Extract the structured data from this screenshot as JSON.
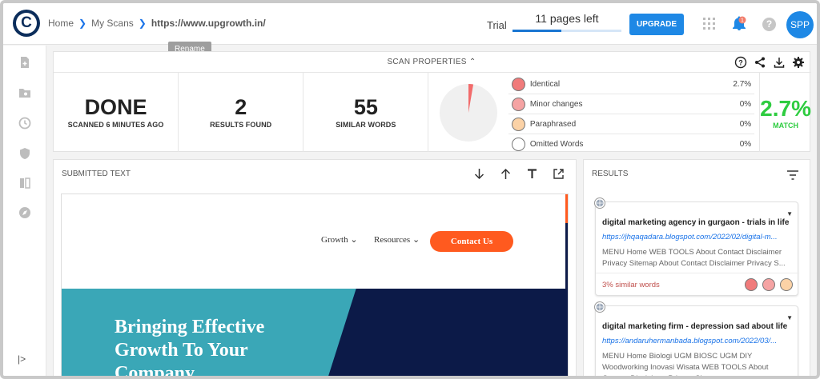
{
  "breadcrumb": {
    "home": "Home",
    "my_scans": "My Scans",
    "url": "https://www.upgrowth.in/"
  },
  "tooltip": {
    "rename": "Rename"
  },
  "header": {
    "trial_label": "Trial",
    "pages_left": "11 pages left",
    "pages_used_fraction": 0.45,
    "upgrade_label": "UPGRADE",
    "notification_count": "1",
    "avatar_initials": "SPP"
  },
  "icons": {
    "logo": "copyleaks-logo",
    "apps": "grid-icon",
    "notifications": "bell-icon",
    "help": "help-icon"
  },
  "scan_properties": {
    "title": "SCAN PROPERTIES",
    "status": {
      "value": "DONE",
      "label": "SCANNED 6 MINUTES AGO"
    },
    "results_found": {
      "value": "2",
      "label": "RESULTS FOUND"
    },
    "similar_words": {
      "value": "55",
      "label": "SIMILAR WORDS"
    },
    "pie_identical_percent": 2.7,
    "legend": [
      {
        "label": "Identical",
        "percent": "2.7%",
        "color": "#f07b7b"
      },
      {
        "label": "Minor changes",
        "percent": "0%",
        "color": "#f5a3a3"
      },
      {
        "label": "Paraphrased",
        "percent": "0%",
        "color": "#fbd2a6"
      },
      {
        "label": "Omitted Words",
        "percent": "0%",
        "color": "#ffffff"
      }
    ],
    "match": {
      "value": "2.7%",
      "label": "MATCH",
      "color": "#2ecc40"
    }
  },
  "submitted": {
    "title": "SUBMITTED TEXT",
    "preview": {
      "nav_growth": "Growth",
      "nav_resources": "Resources",
      "contact_button": "Contact Us",
      "hero_text": "Bringing Effective Growth To Your Company"
    }
  },
  "results": {
    "title": "RESULTS",
    "cards": [
      {
        "title": "digital marketing agency in gurgaon - trials in life",
        "url": "https://jhqaqadara.blogspot.com/2022/02/digital-m...",
        "description": "MENU Home WEB TOOLS About Contact Disclaimer Privacy Sitemap About Contact Disclaimer Privacy S...",
        "similar": "3% similar words"
      },
      {
        "title": "digital marketing firm - depression sad about life",
        "url": "https://andaruhermanbada.blogspot.com/2022/03/...",
        "description": "MENU Home Biologi UGM BIOSC UGM DIY Woodworking Inovasi Wisata WEB TOOLS About Contact Disclaimer Privacy Sitemap ...",
        "similar": ""
      }
    ]
  }
}
